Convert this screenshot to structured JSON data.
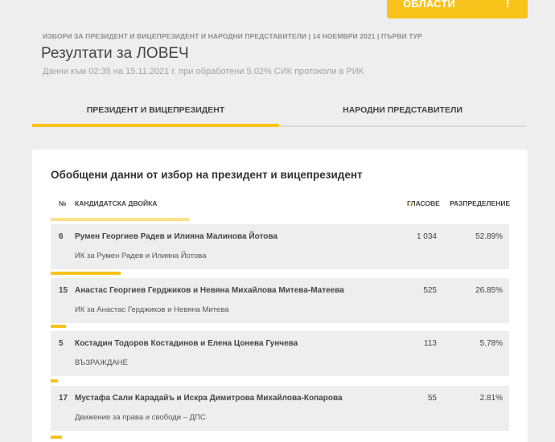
{
  "header": {
    "regions_label": "ОБЛАСТИ",
    "regions_icon": "!",
    "election_line": "ИЗБОРИ ЗА ПРЕЗИДЕНТ И ВИЦЕПРЕЗИДЕНТ И НАРОДНИ ПРЕДСТАВИТЕЛИ | 14 НОЕМВРИ 2021 | ПЪРВИ ТУР",
    "title": "Резултати за ЛОВЕЧ",
    "data_line": "Данни към 02:35 на 15.11.2021 г. при обработени 5.02% СИК протоколи в РИК"
  },
  "tabs": [
    {
      "label": "ПРЕЗИДЕНТ И ВИЦЕПРЕЗИДЕНТ",
      "active": true
    },
    {
      "label": "НАРОДНИ ПРЕДСТАВИТЕЛИ",
      "active": false
    }
  ],
  "summary": {
    "title": "Обобщени данни от избор на президент и вицепрезидент",
    "columns": {
      "num": "№",
      "candidates": "КАНДИДАТСКА ДВОЙКА",
      "votes": "ГЛАСОВЕ",
      "share": "РАЗПРЕДЕЛЕНИЕ"
    },
    "rows": [
      {
        "num": "6",
        "name": "Румен Георгиев Радев и Илияна Малинова Йотова",
        "party": "ИК за Румен Радев и Илияна Йотова",
        "votes": "1 034",
        "pct": "52.89%",
        "share": 52.89
      },
      {
        "num": "15",
        "name": "Анастас Георгиев Герджиков и Невяна Михайлова Митева-Матеева",
        "party": "ИК за Анастас Герджиков и Невяна Митева",
        "votes": "525",
        "pct": "26.85%",
        "share": 26.85
      },
      {
        "num": "5",
        "name": "Костадин Тодоров Костадинов и Елена Цонева Гунчева",
        "party": "ВЪЗРАЖДАНЕ",
        "votes": "113",
        "pct": "5.78%",
        "share": 5.78
      },
      {
        "num": "17",
        "name": "Мустафа Сали Карадайъ и Искра Димитрова Михайлова-Копарова",
        "party": "Движение за права и свободи – ДПС",
        "votes": "55",
        "pct": "2.81%",
        "share": 2.81
      }
    ]
  }
}
